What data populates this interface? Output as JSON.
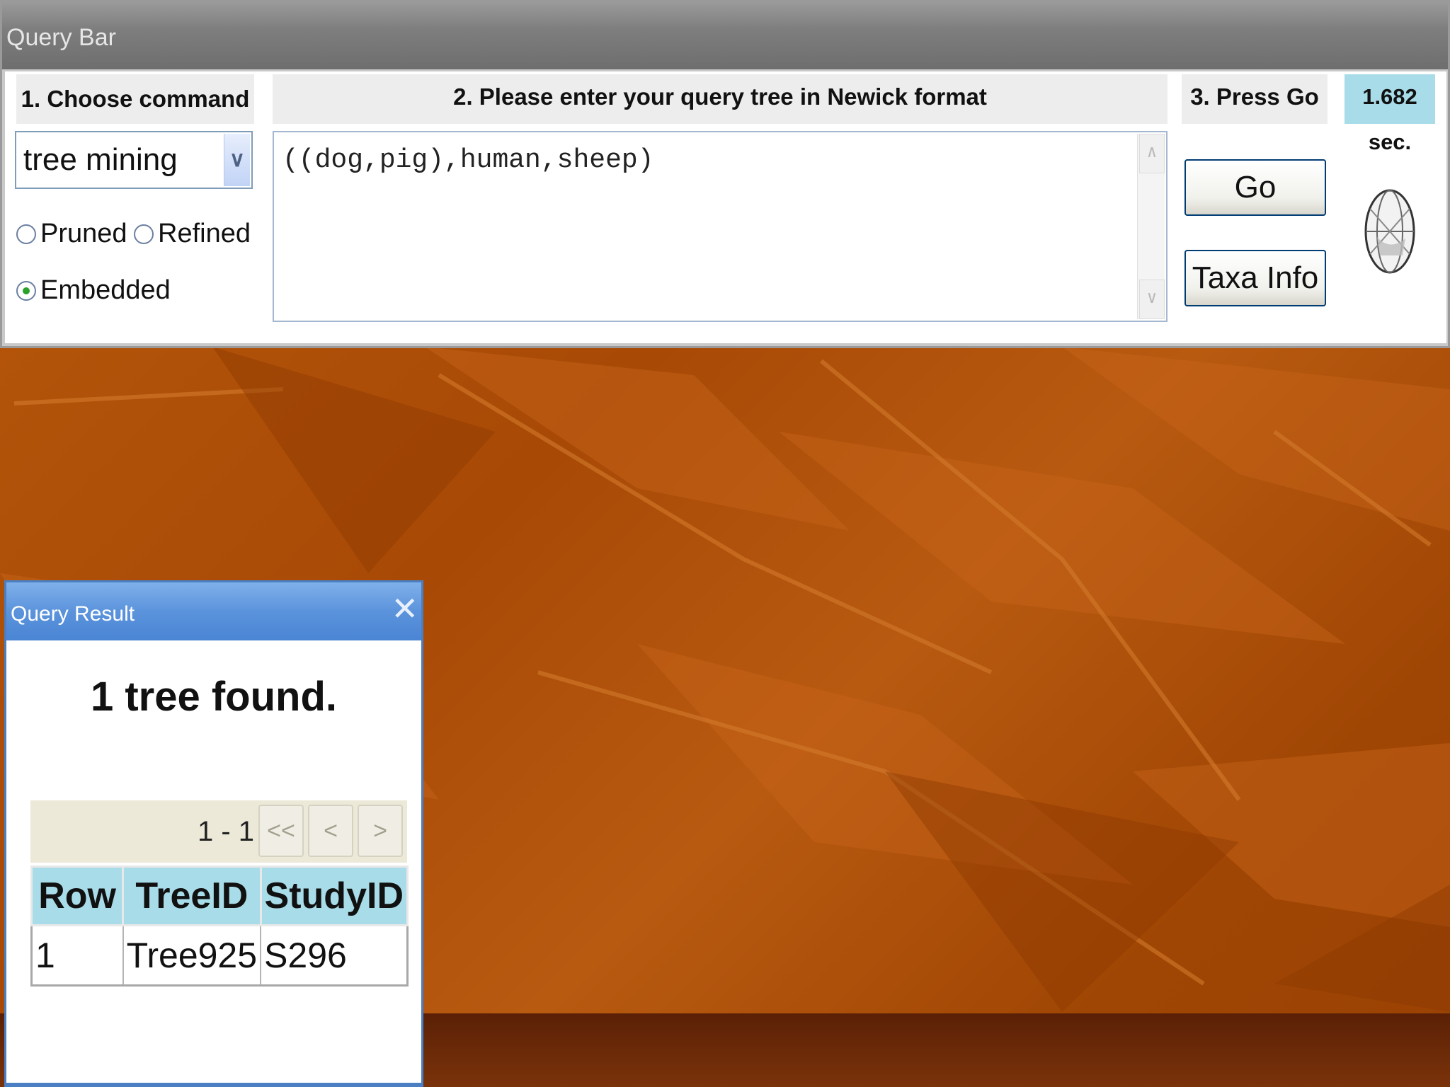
{
  "query_bar": {
    "title": "Query Bar",
    "step1_label": "1. Choose  command",
    "step2_label": "2. Please enter your query tree in Newick format",
    "step3_label": "3. Press Go",
    "elapsed": "1.682 sec.",
    "command_select": {
      "value": "tree mining"
    },
    "radio_options": [
      {
        "label": "Pruned",
        "checked": false
      },
      {
        "label": "Refined",
        "checked": false
      },
      {
        "label": "Embedded",
        "checked": true
      }
    ],
    "query_text": "((dog,pig),human,sheep)",
    "go_button": "Go",
    "taxa_button": "Taxa Info"
  },
  "query_result": {
    "title": "Query Result",
    "message": "1 tree found.",
    "pager": {
      "range": "1 - 1",
      "first": "<<",
      "prev": "<",
      "next": ">"
    },
    "table": {
      "headers": [
        "Row",
        "TreeID",
        "StudyID"
      ],
      "rows": [
        [
          "1",
          "Tree925",
          "S296"
        ]
      ]
    }
  },
  "colors": {
    "desktop": "#a8480a",
    "result_header": "#a9dce9",
    "dialog_titlebar": "#5b93dc"
  }
}
